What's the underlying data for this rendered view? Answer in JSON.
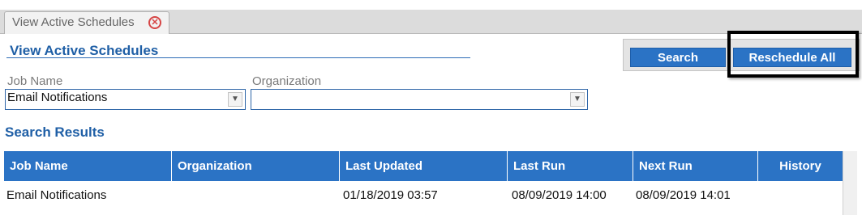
{
  "tab": {
    "label": "View Active Schedules",
    "close_icon": "close-circle-icon"
  },
  "page": {
    "title": "View Active Schedules"
  },
  "actions": {
    "search_label": "Search",
    "reschedule_all_label": "Reschedule All"
  },
  "filters": {
    "job_name": {
      "label": "Job Name",
      "value": "Email Notifications"
    },
    "organization": {
      "label": "Organization",
      "value": ""
    }
  },
  "results": {
    "title": "Search Results",
    "columns": [
      "Job Name",
      "Organization",
      "Last Updated",
      "Last Run",
      "Next Run",
      "History"
    ],
    "rows": [
      {
        "job_name": "Email Notifications",
        "organization": "",
        "last_updated": "01/18/2019 03:57",
        "last_run": "08/09/2019 14:00",
        "next_run": "08/09/2019 14:01",
        "history": ""
      }
    ]
  },
  "colors": {
    "accent": "#2b73c5",
    "title": "#1f5fa6",
    "close": "#d64545"
  }
}
